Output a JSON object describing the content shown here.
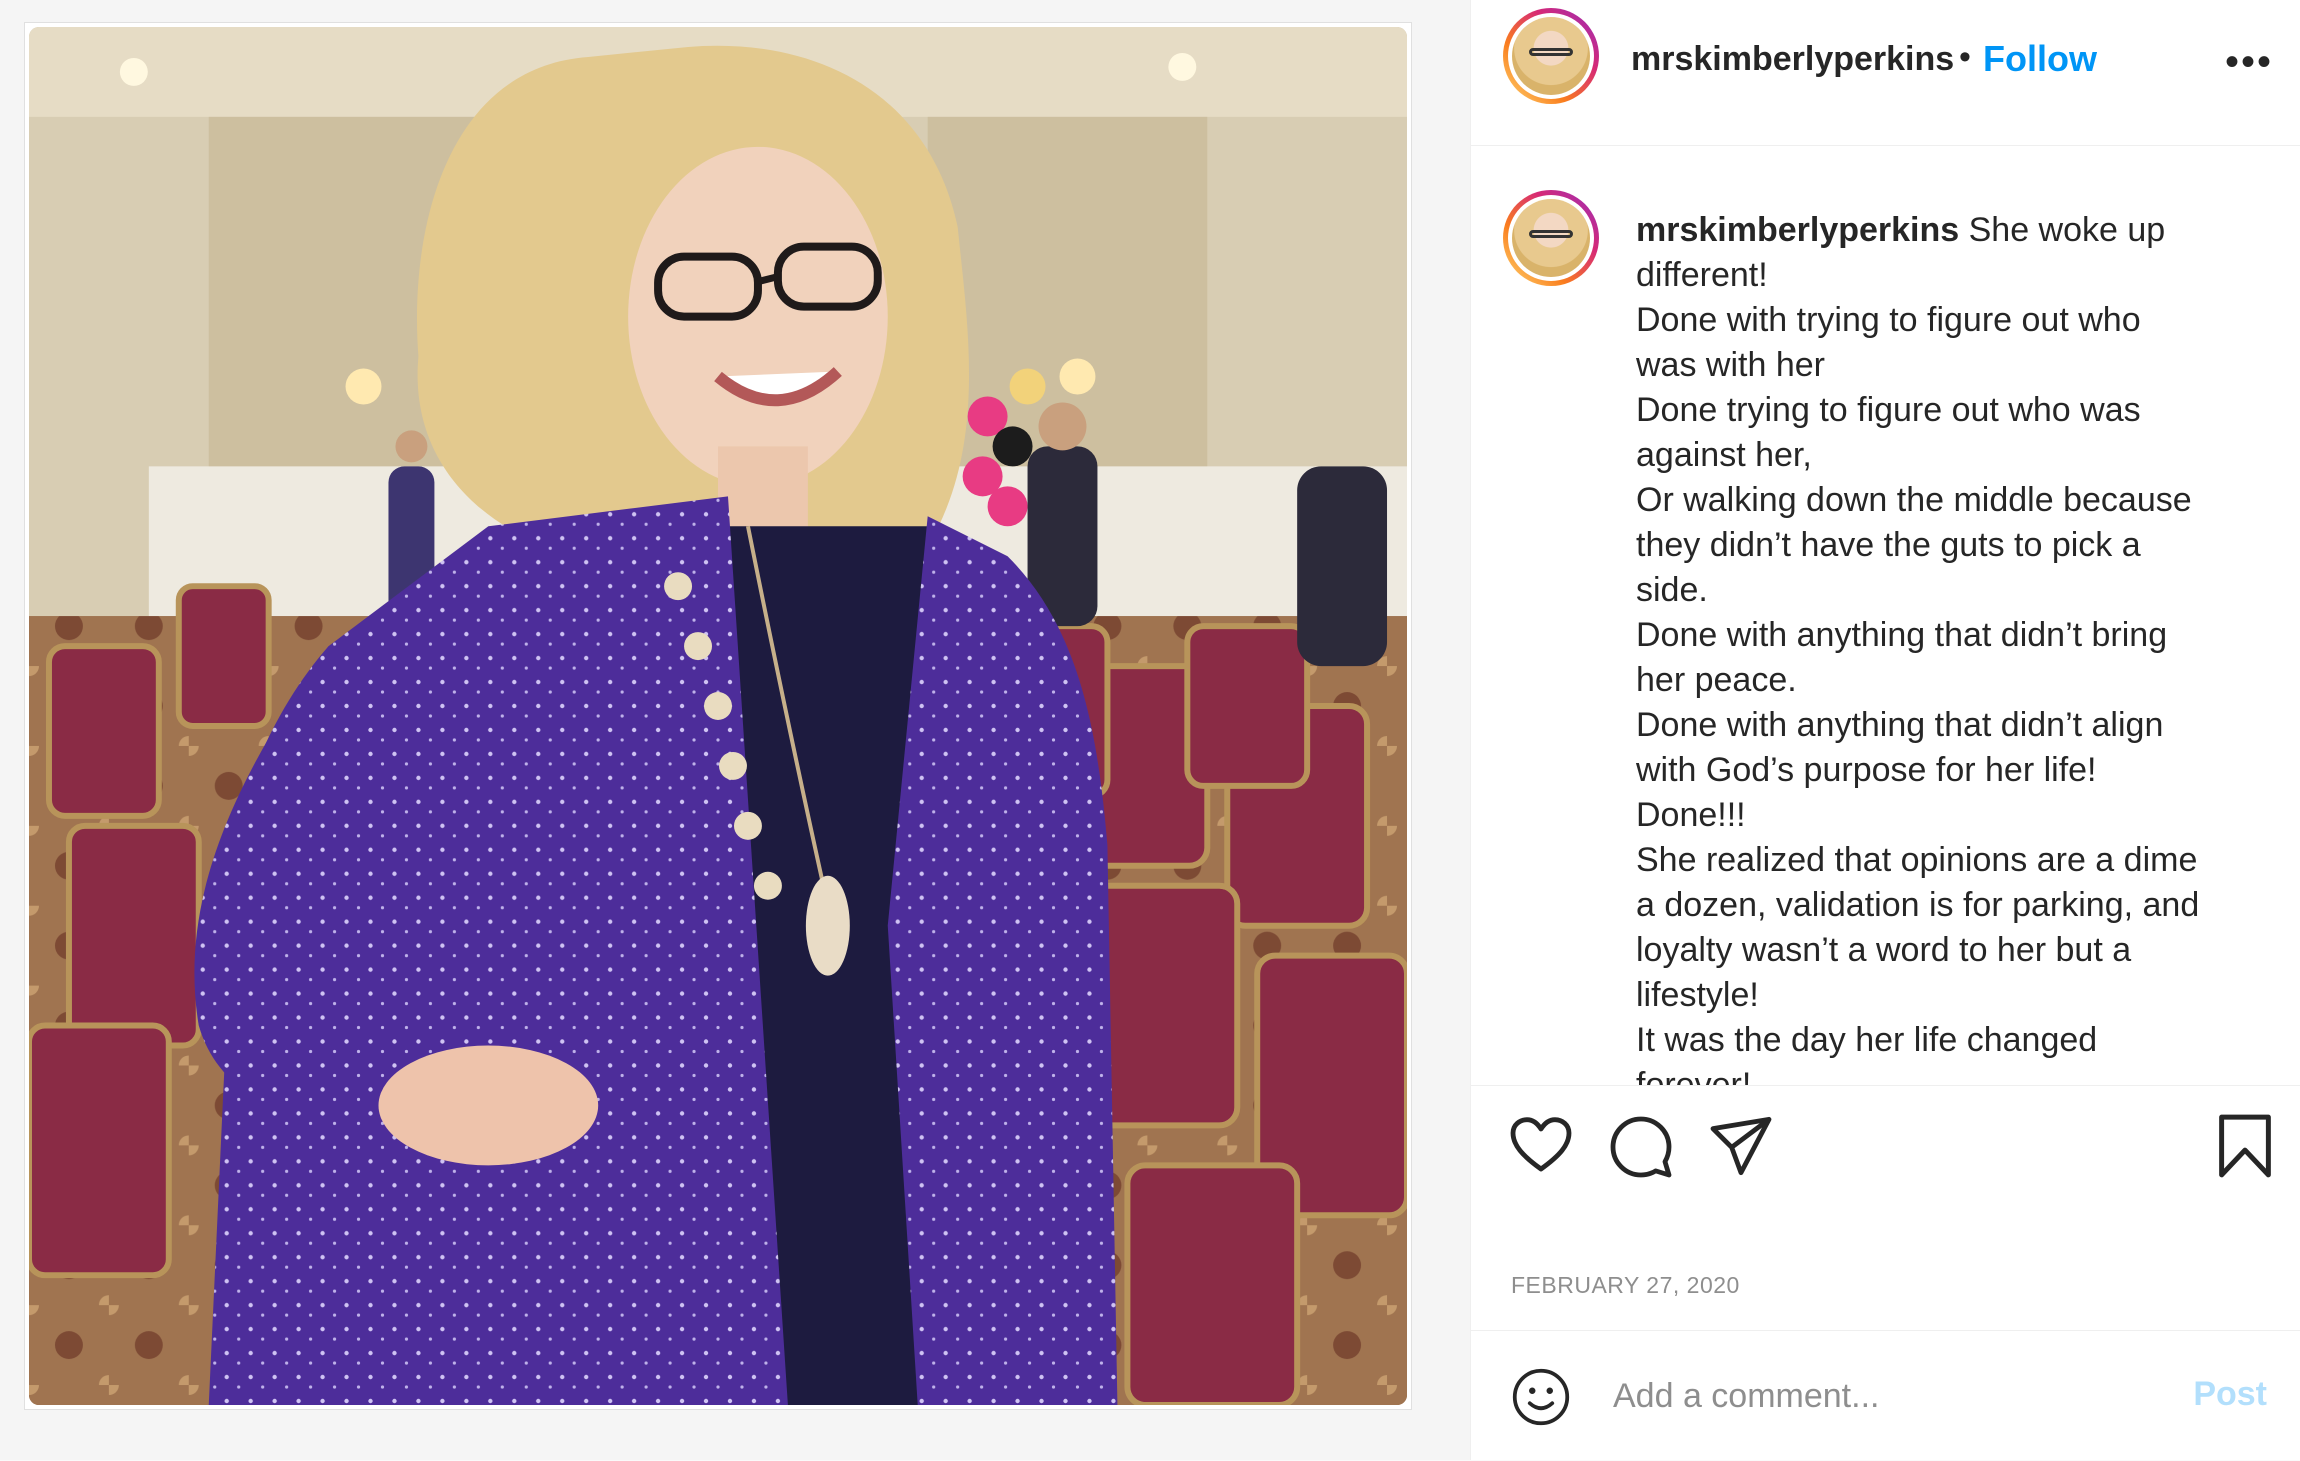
{
  "post": {
    "username": "mrskimberlyperkins",
    "follow_label": "Follow",
    "separator": "•",
    "more_label": "•••",
    "image_alt": "Woman in a purple sparkly jacket standing in a banquet hall"
  },
  "caption": {
    "username": "mrskimberlyperkins",
    "first_line": " She woke up",
    "lines": [
      "different!",
      "Done with trying to figure out who",
      "was with her",
      "Done trying to figure out who was",
      "against her,",
      "Or walking down the middle because",
      "they didn’t have the guts to pick a",
      "side.",
      "Done with anything that didn’t bring",
      "her peace.",
      "Done with anything that didn’t align",
      "with God’s purpose for her life!",
      "Done!!!",
      "She realized that opinions are a dime",
      "a dozen, validation is for parking, and",
      "loyalty wasn’t a word to her but a",
      "lifestyle!",
      "It was the day her life changed",
      "forever!"
    ]
  },
  "actions": {
    "like_icon": "heart-icon",
    "comment_icon": "comment-icon",
    "share_icon": "paper-plane-icon",
    "save_icon": "bookmark-icon"
  },
  "date": "FEBRUARY 27, 2020",
  "comment_box": {
    "placeholder": "Add a comment...",
    "post_label": "Post"
  },
  "colors": {
    "link_blue": "#0095f6",
    "post_disabled": "#b2dffc",
    "muted": "#8e8e8e"
  }
}
